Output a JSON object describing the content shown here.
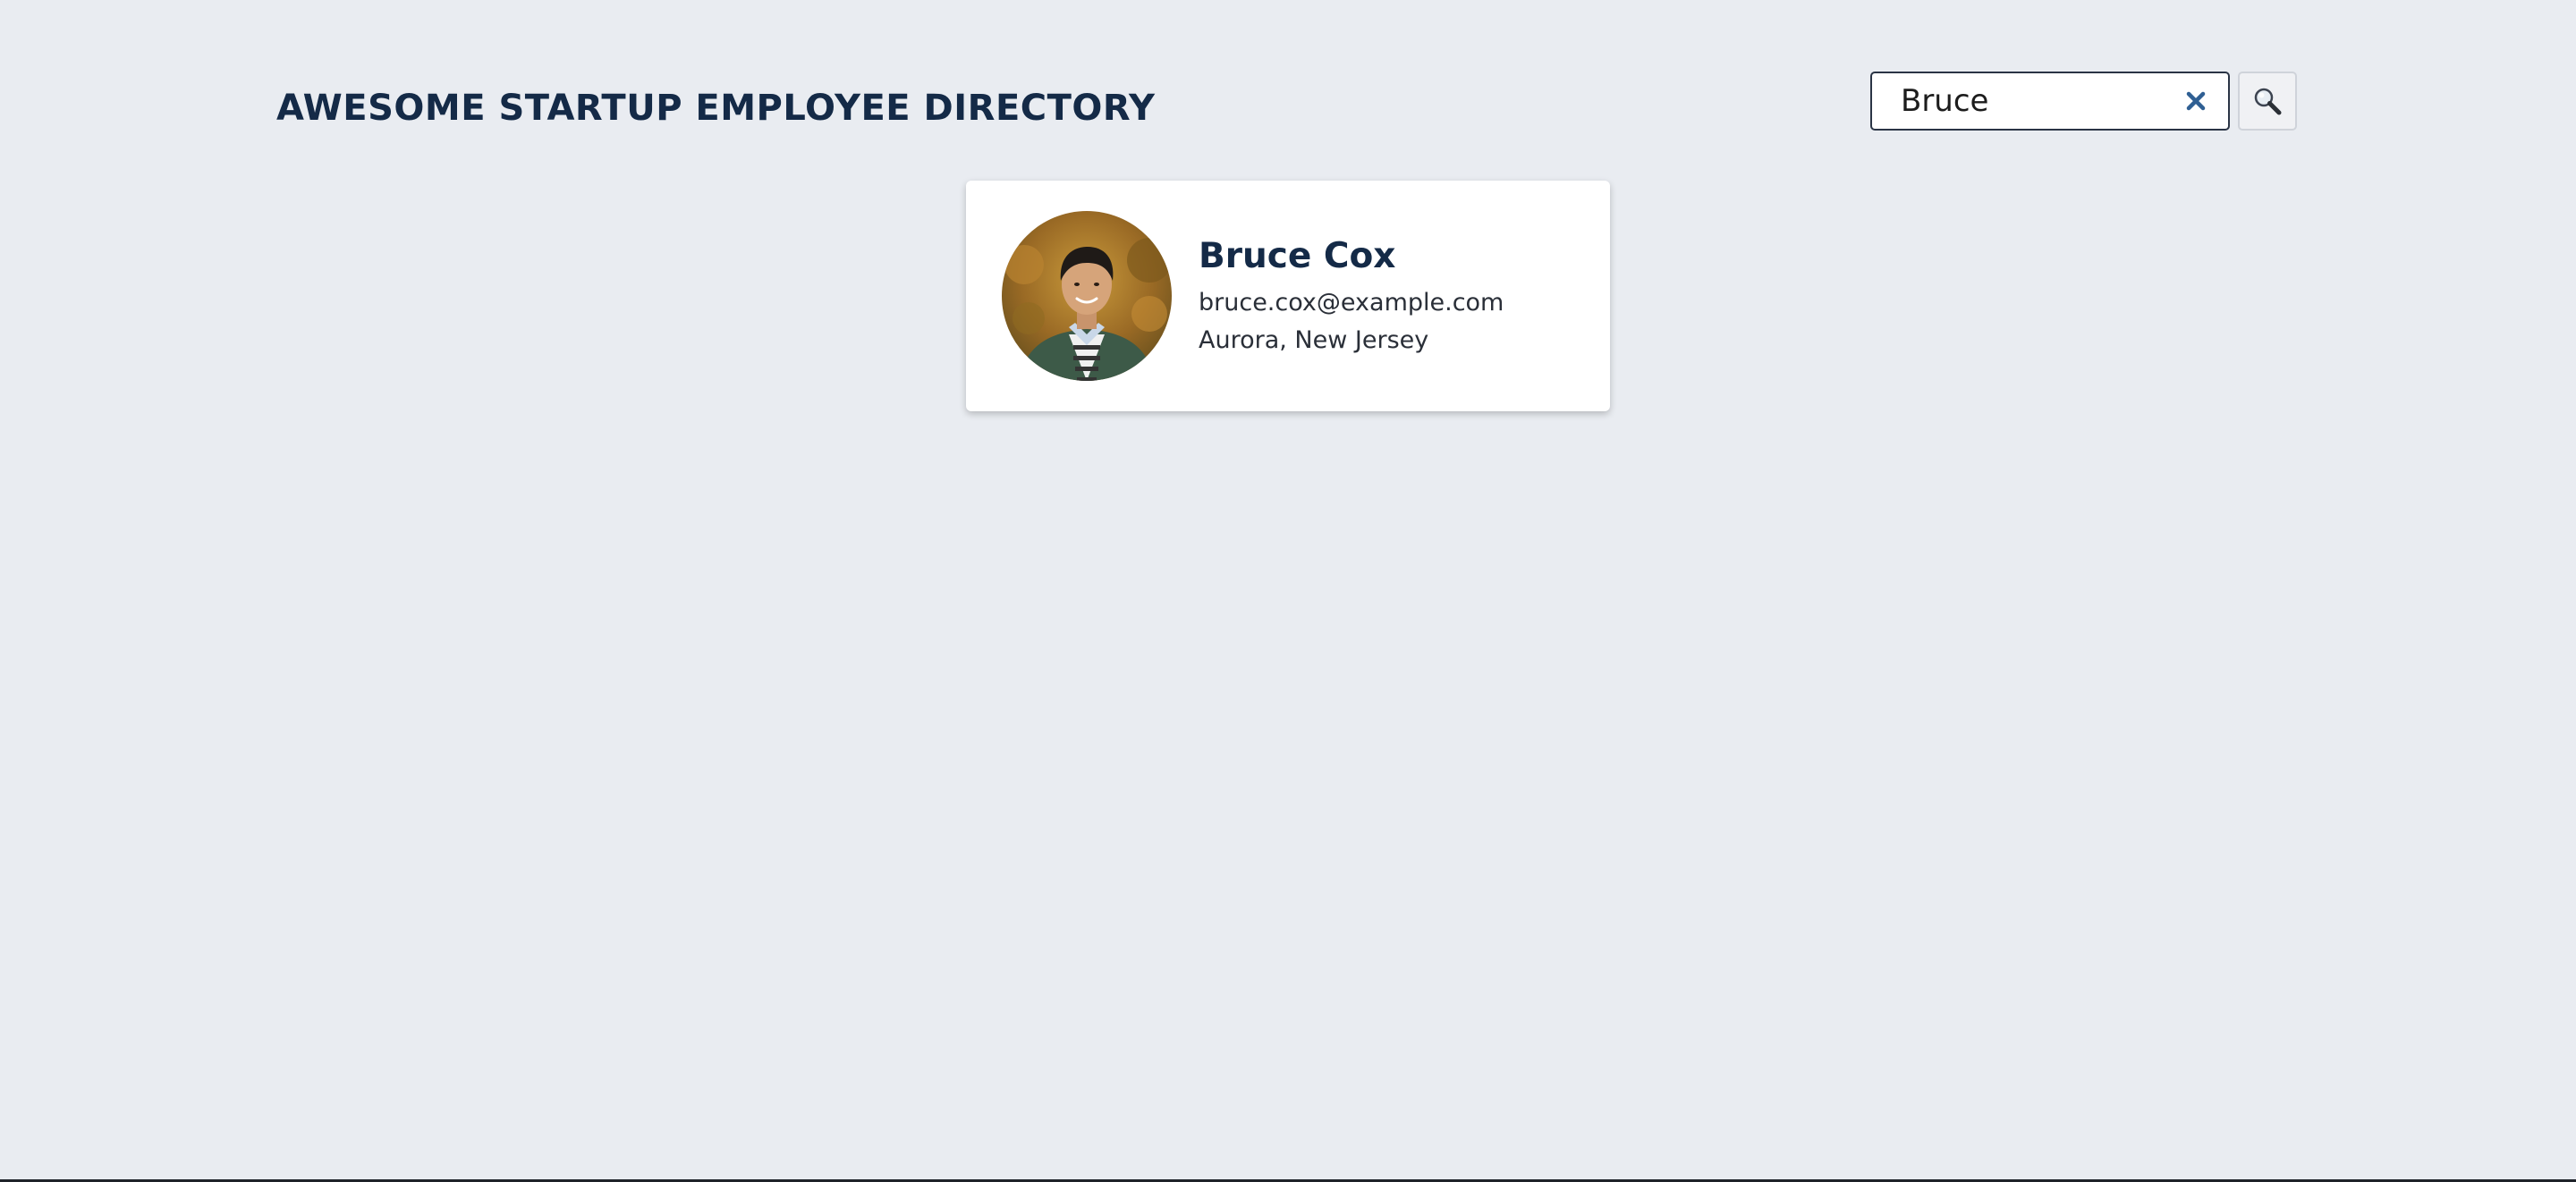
{
  "header": {
    "title": "AWESOME STARTUP EMPLOYEE DIRECTORY"
  },
  "search": {
    "value": "Bruce",
    "clear_icon": "close-icon",
    "search_icon": "magnifier-icon"
  },
  "results": [
    {
      "name": "Bruce Cox",
      "email": "bruce.cox@example.com",
      "location": "Aurora, New Jersey"
    }
  ],
  "colors": {
    "background": "#e9ecf1",
    "heading": "#142a47",
    "clear_icon": "#2f5f93",
    "card": "#ffffff"
  }
}
